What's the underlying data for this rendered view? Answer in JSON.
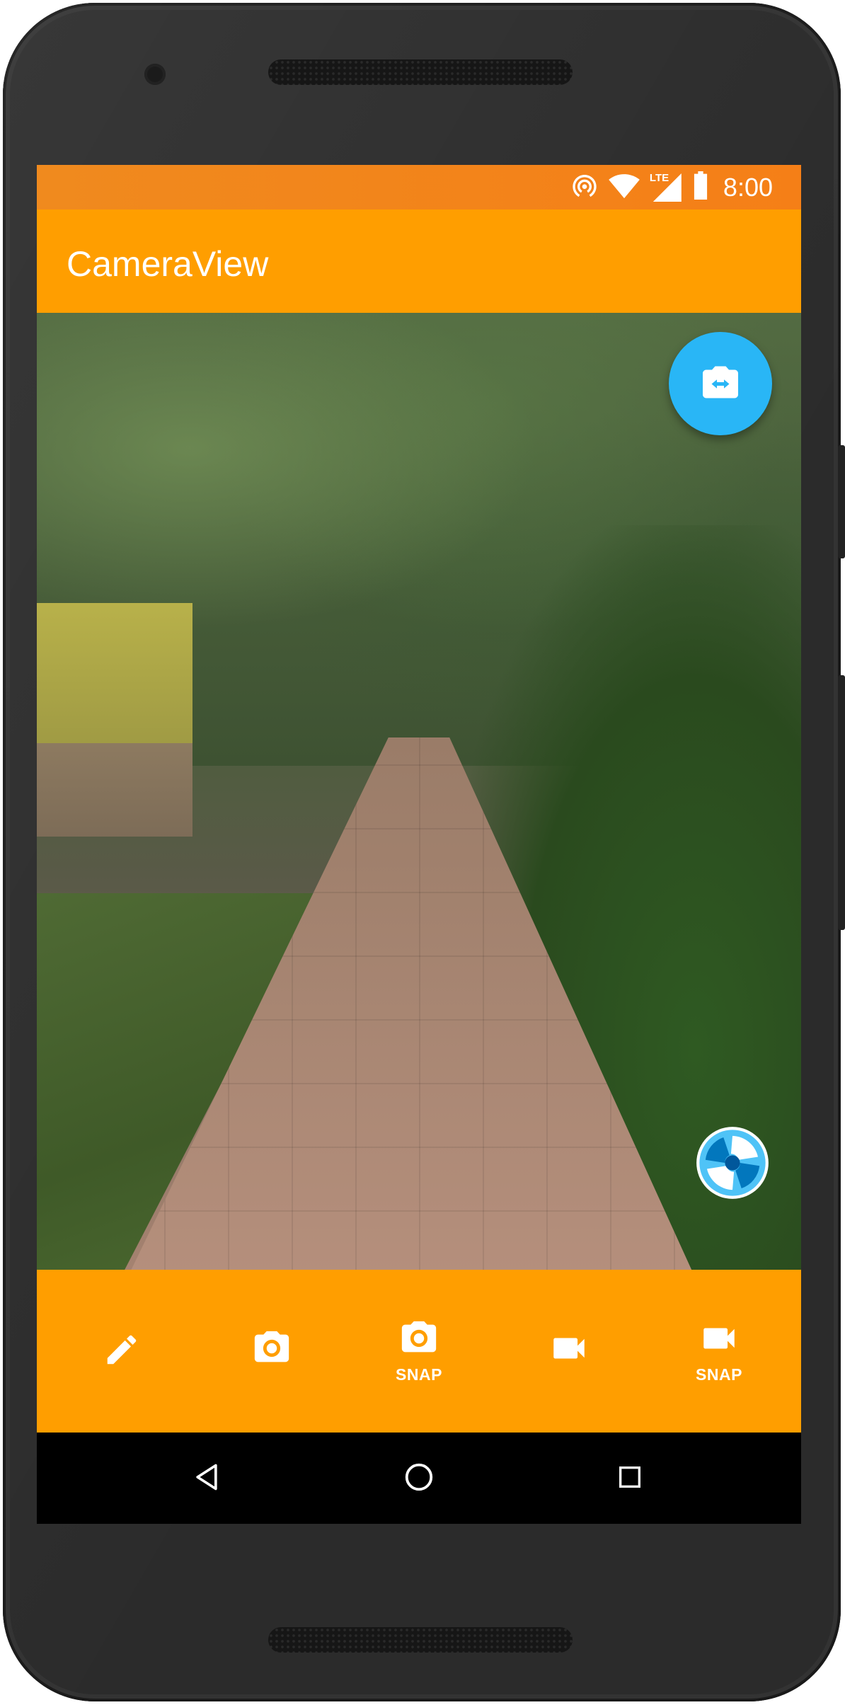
{
  "status_bar": {
    "time": "8:00",
    "icons": [
      "hotspot-icon",
      "wifi-icon",
      "lte-signal-icon",
      "battery-icon"
    ],
    "lte_label": "LTE"
  },
  "app_bar": {
    "title": "CameraView"
  },
  "viewfinder": {
    "toggle_camera_icon": "switch-camera-icon",
    "watermark_icon": "camera-shutter-logo-icon"
  },
  "bottom_bar": {
    "buttons": [
      {
        "icon": "pencil-icon",
        "label": ""
      },
      {
        "icon": "camera-icon",
        "label": ""
      },
      {
        "icon": "camera-icon",
        "label": "SNAP"
      },
      {
        "icon": "videocam-icon",
        "label": ""
      },
      {
        "icon": "videocam-icon",
        "label": "SNAP"
      }
    ]
  },
  "nav_bar": {
    "items": [
      "back-icon",
      "home-icon",
      "recents-icon"
    ]
  },
  "colors": {
    "status_bar": "#f57f17",
    "app_bar": "#ff9e00",
    "fab": "#29b6f6",
    "nav_bar": "#000000",
    "device": "#2b2b2b"
  }
}
